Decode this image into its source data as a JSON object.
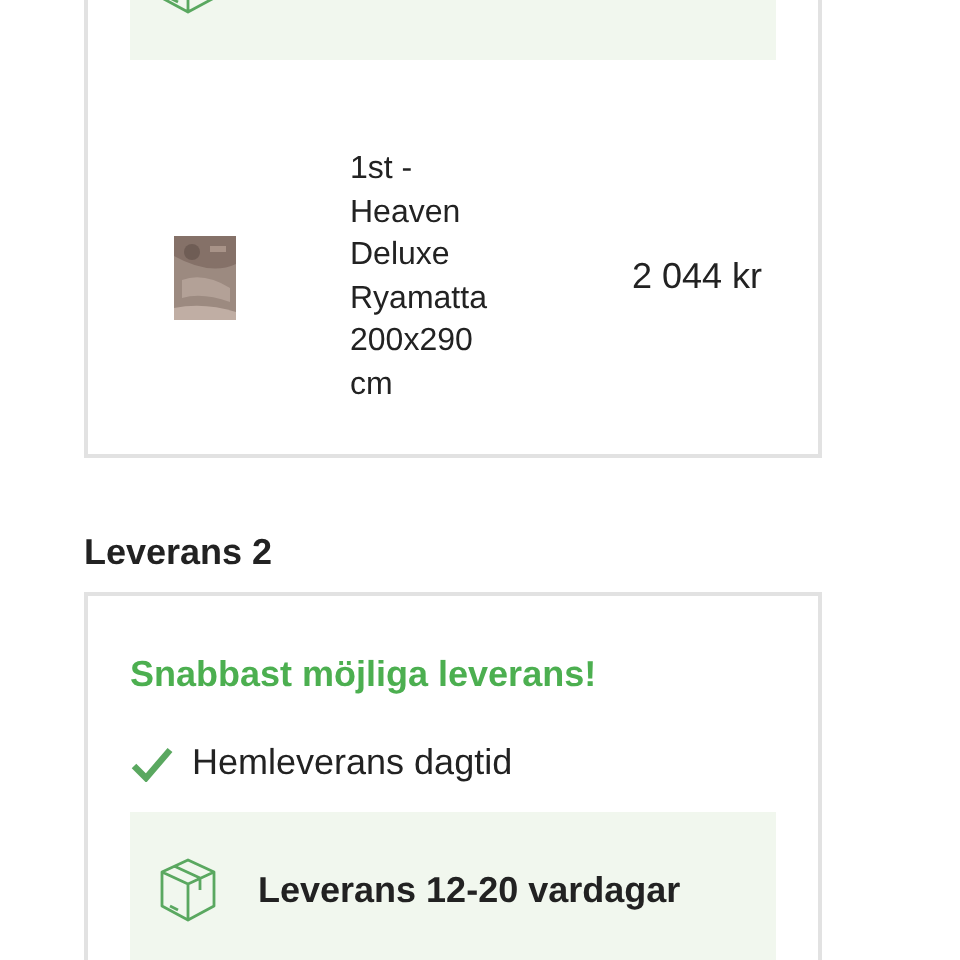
{
  "deliveries": [
    {
      "items": [
        {
          "name": "1st - Heaven Deluxe Ryamatta 200x290 cm",
          "price": "2 044 kr",
          "kind": "picture"
        }
      ]
    },
    {
      "heading": "Leverans 2",
      "promo": "Snabbast möjliga leverans!",
      "options": [
        {
          "label": "Hemleverans dagtid",
          "checked": true
        }
      ],
      "estimate": "Leverans 12-20 vardagar"
    }
  ]
}
